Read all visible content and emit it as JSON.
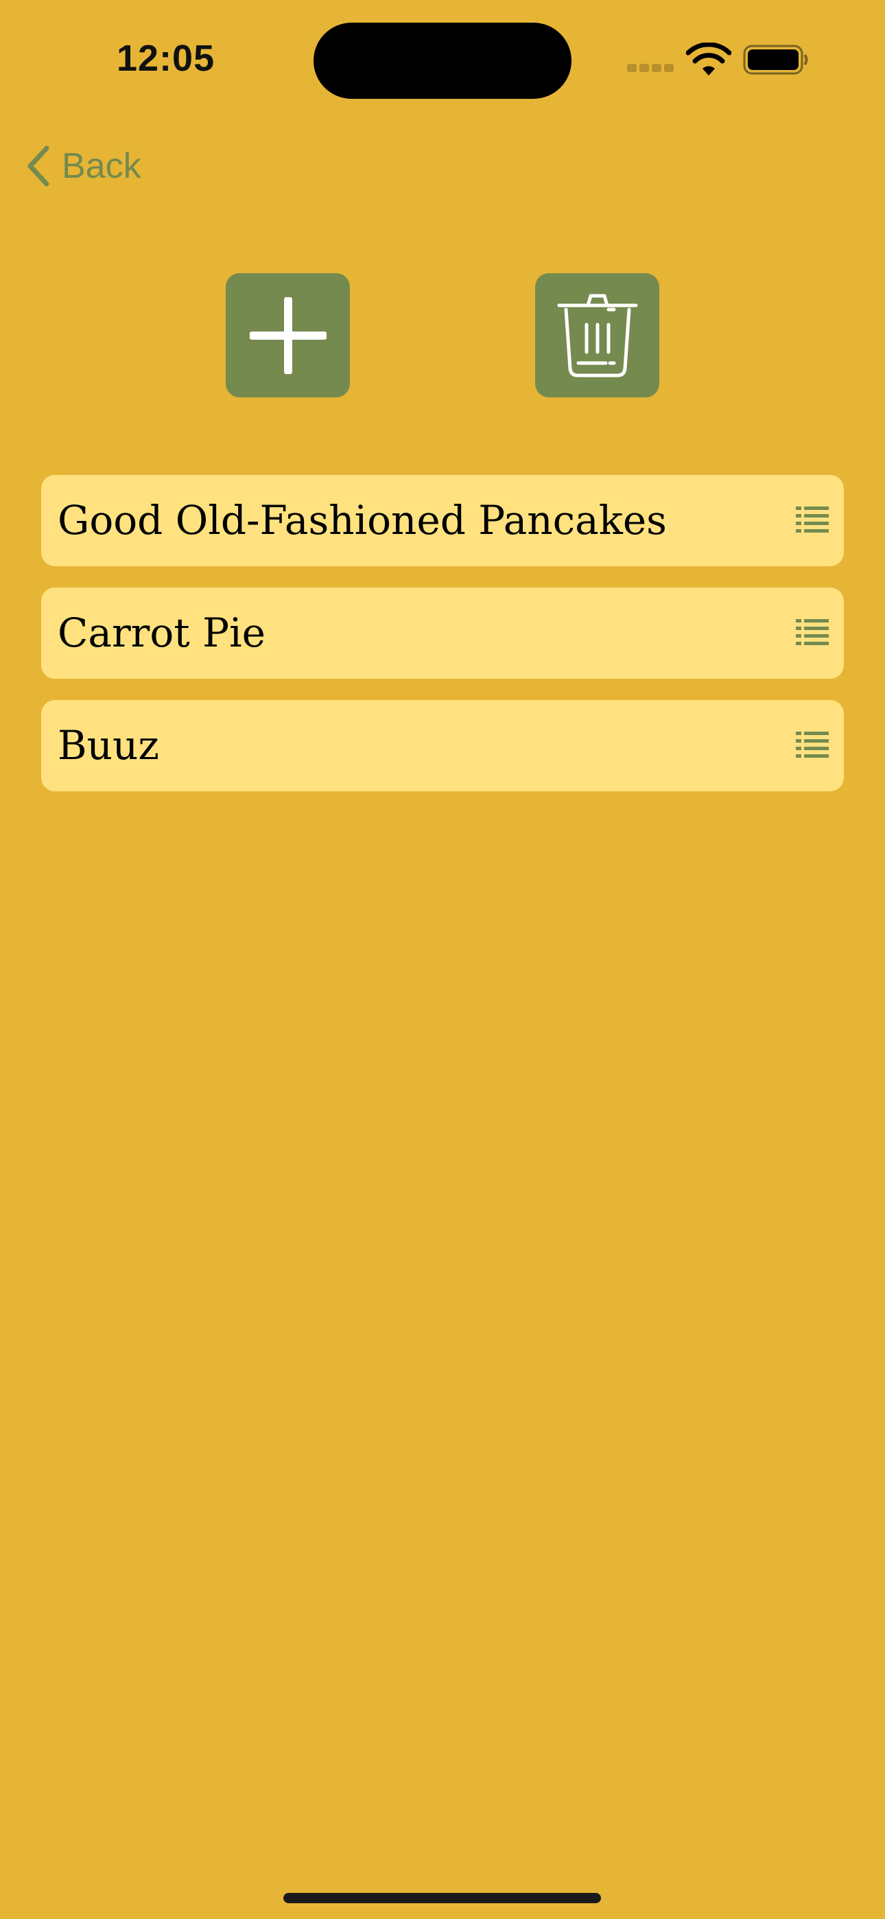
{
  "status_bar": {
    "time": "12:05",
    "icons": [
      "signal-icon",
      "wifi-icon",
      "battery-icon"
    ]
  },
  "nav": {
    "back_label": "Back",
    "back_icon": "chevron-left-icon"
  },
  "actions": {
    "add_icon": "plus-icon",
    "delete_icon": "trash-icon"
  },
  "recipes": [
    {
      "title": "Good Old-Fashioned Pancakes",
      "icon": "list-icon"
    },
    {
      "title": "Carrot Pie",
      "icon": "list-icon"
    },
    {
      "title": "Buuz",
      "icon": "list-icon"
    }
  ],
  "colors": {
    "background": "#E6B536",
    "accent": "#758A4E",
    "row_background": "#FFE27F",
    "text": "#000000"
  }
}
